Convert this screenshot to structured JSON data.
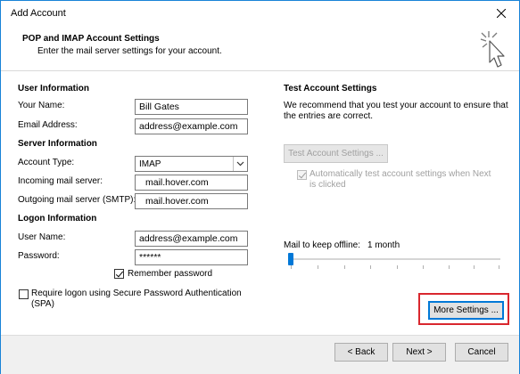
{
  "window": {
    "title": "Add Account",
    "close_icon": "close-icon"
  },
  "header": {
    "title": "POP and IMAP Account Settings",
    "subtitle": "Enter the mail server settings for your account.",
    "icon": "cursor-sparkle-icon"
  },
  "user_info": {
    "heading": "User Information",
    "name_label": "Your Name:",
    "name_value": "Bill Gates",
    "email_label": "Email Address:",
    "email_value": "address@example.com"
  },
  "server_info": {
    "heading": "Server Information",
    "account_type_label": "Account Type:",
    "account_type_value": "IMAP",
    "incoming_label": "Incoming mail server:",
    "incoming_value": "mail.hover.com",
    "outgoing_label": "Outgoing mail server (SMTP):",
    "outgoing_value": "mail.hover.com"
  },
  "logon_info": {
    "heading": "Logon Information",
    "username_label": "User Name:",
    "username_value": "address@example.com",
    "password_label": "Password:",
    "password_value": "******",
    "remember_label": "Remember password",
    "remember_checked": true,
    "spa_label_line1": "Require logon using Secure Password Authentication",
    "spa_label_line2": "(SPA)",
    "spa_checked": false
  },
  "test_settings": {
    "heading": "Test Account Settings",
    "description_line1": "We recommend that you test your account to ensure that",
    "description_line2": "the entries are correct.",
    "test_button": "Test Account Settings ...",
    "auto_test_line1": "Automatically test account settings when Next",
    "auto_test_line2": "is clicked",
    "auto_test_checked": true
  },
  "offline": {
    "label": "Mail to keep offline:",
    "value": "1 month",
    "slider_level": 0.0
  },
  "more_settings_button": "More Settings ...",
  "footer": {
    "back_button": "< Back",
    "next_button": "Next >",
    "cancel_button": "Cancel"
  },
  "colors": {
    "accent": "#0078d7",
    "highlight": "#d9272e",
    "border": "#1883d7"
  }
}
